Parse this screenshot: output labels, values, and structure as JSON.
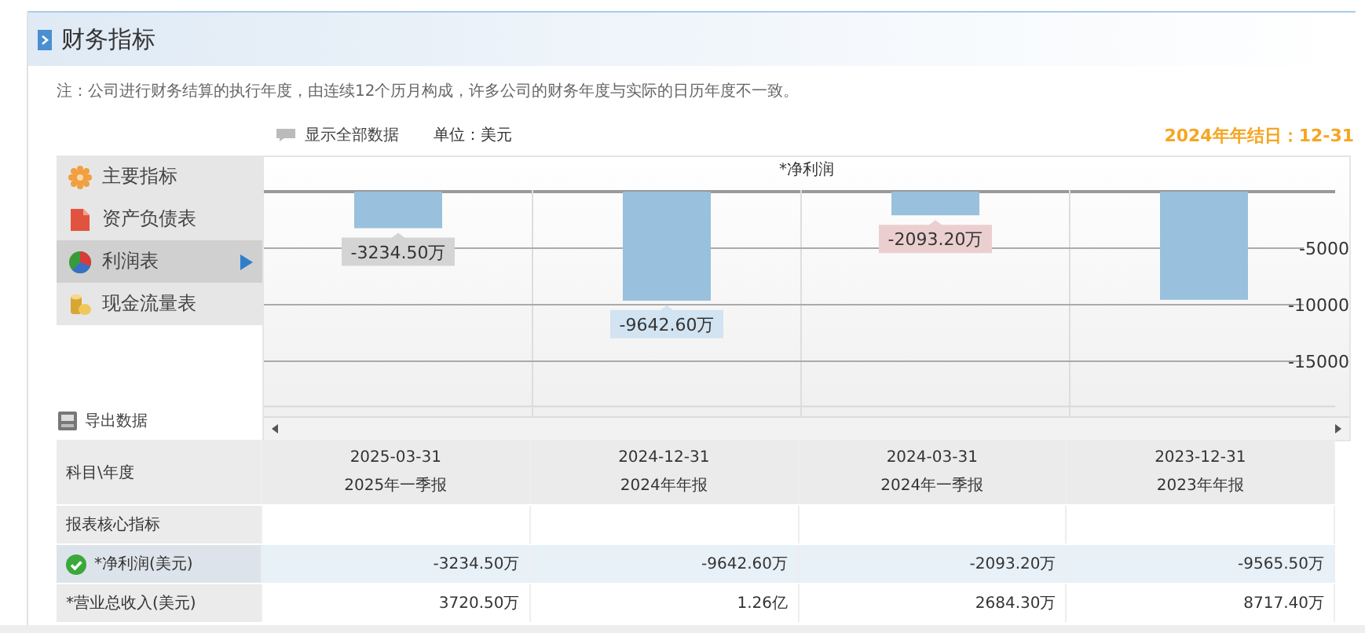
{
  "section": {
    "title": "财务指标"
  },
  "note": "注：公司进行财务结算的执行年度，由连续12个历月构成，许多公司的财务年度与实际的日历年度不一致。",
  "toolbar": {
    "show_all": "显示全部数据",
    "unit": "单位：美元"
  },
  "fiscal_year_end": "2024年年结日：12-31",
  "sidebar": {
    "items": [
      {
        "label": "主要指标",
        "selected": false
      },
      {
        "label": "资产负债表",
        "selected": false
      },
      {
        "label": "利润表",
        "selected": true
      },
      {
        "label": "现金流量表",
        "selected": false
      }
    ],
    "export": "导出数据"
  },
  "chart_data": {
    "type": "bar",
    "title": "*净利润",
    "values": [
      -3234.5,
      -9642.6,
      -2093.2,
      -9565.5
    ],
    "ylim": [
      -19000,
      0
    ],
    "yticks": [
      -5000,
      -10000,
      -15000
    ],
    "grid": true,
    "value_labels": [
      "-3234.50万",
      "-9642.60万",
      "-2093.20万",
      null
    ]
  },
  "table": {
    "corner": "科目\\年度",
    "columns": [
      {
        "date": "2025-03-31",
        "period": "2025年一季报"
      },
      {
        "date": "2024-12-31",
        "period": "2024年年报"
      },
      {
        "date": "2024-03-31",
        "period": "2024年一季报"
      },
      {
        "date": "2023-12-31",
        "period": "2023年年报"
      }
    ],
    "rows": [
      {
        "kind": "section",
        "label": "报表核心指标",
        "selected": false
      },
      {
        "kind": "data",
        "label": "*净利润(美元)",
        "selected": true,
        "values": [
          "-3234.50万",
          "-9642.60万",
          "-2093.20万",
          "-9565.50万"
        ]
      },
      {
        "kind": "data",
        "label": "*营业总收入(美元)",
        "selected": false,
        "values": [
          "3720.50万",
          "1.26亿",
          "2684.30万",
          "8717.40万"
        ]
      }
    ]
  }
}
